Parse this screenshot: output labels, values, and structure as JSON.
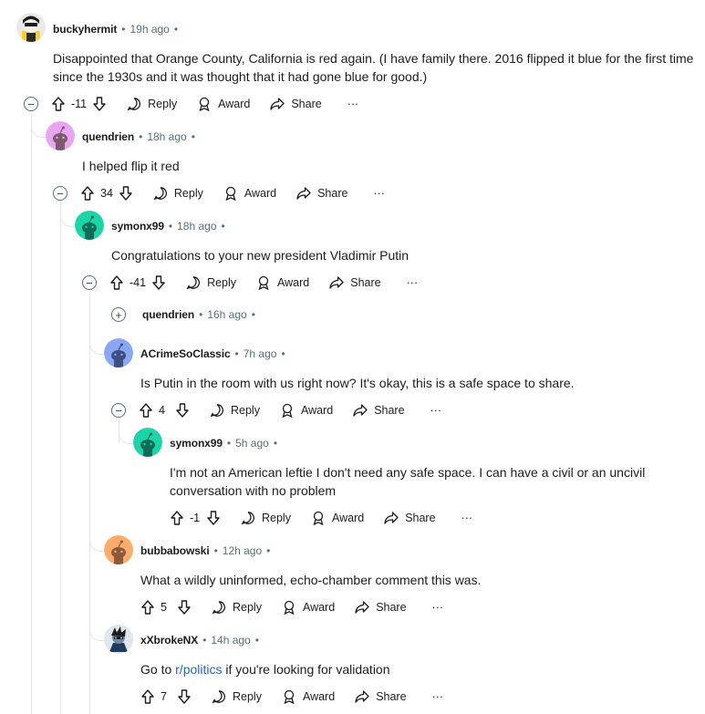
{
  "comments": [
    {
      "user": "buckyhermit",
      "time": "19h ago",
      "text": "Disappointed that Orange County, California is red again. (I have family there. 2016 flipped it blue for the first time since the 1930s and it was thought that it had gone blue for good.)",
      "score": "-11"
    },
    {
      "user": "quendrien",
      "time": "18h ago",
      "text": "I helped flip it red",
      "score": "34"
    },
    {
      "user": "symonx99",
      "time": "18h ago",
      "text": "Congratulations to your new president Vladimir Putin",
      "score": "-41"
    },
    {
      "user": "quendrien",
      "time": "16h ago",
      "collapsed": true
    },
    {
      "user": "ACrimeSoClassic",
      "time": "7h ago",
      "text": "Is Putin in the room with us right now? It's okay, this is a safe space to share.",
      "score": "4"
    },
    {
      "user": "symonx99",
      "time": "5h ago",
      "text": "I'm not an American leftie I don't need any safe space. I can have a civil or an uncivil conversation with no problem",
      "score": "-1"
    },
    {
      "user": "bubbabowski",
      "time": "12h ago",
      "text": "What a wildly uninformed, echo-chamber comment this was.",
      "score": "5"
    },
    {
      "user": "xXbrokeNX",
      "time": "14h ago",
      "text_before": "Go to ",
      "link": "r/politics",
      "text_after": " if you're looking for validation",
      "score": "7"
    }
  ],
  "actions": {
    "reply": "Reply",
    "award": "Award",
    "share": "Share",
    "more": "···",
    "dot": "•"
  },
  "colors": {
    "link": "#2a64c2",
    "meta": "#576f76",
    "thread_line": "#e5e7ea",
    "avatar_pink": "#e8a6f0",
    "avatar_teal": "#1ad6a6",
    "avatar_blue": "#8aa7f5",
    "avatar_orange": "#ffac6b"
  }
}
